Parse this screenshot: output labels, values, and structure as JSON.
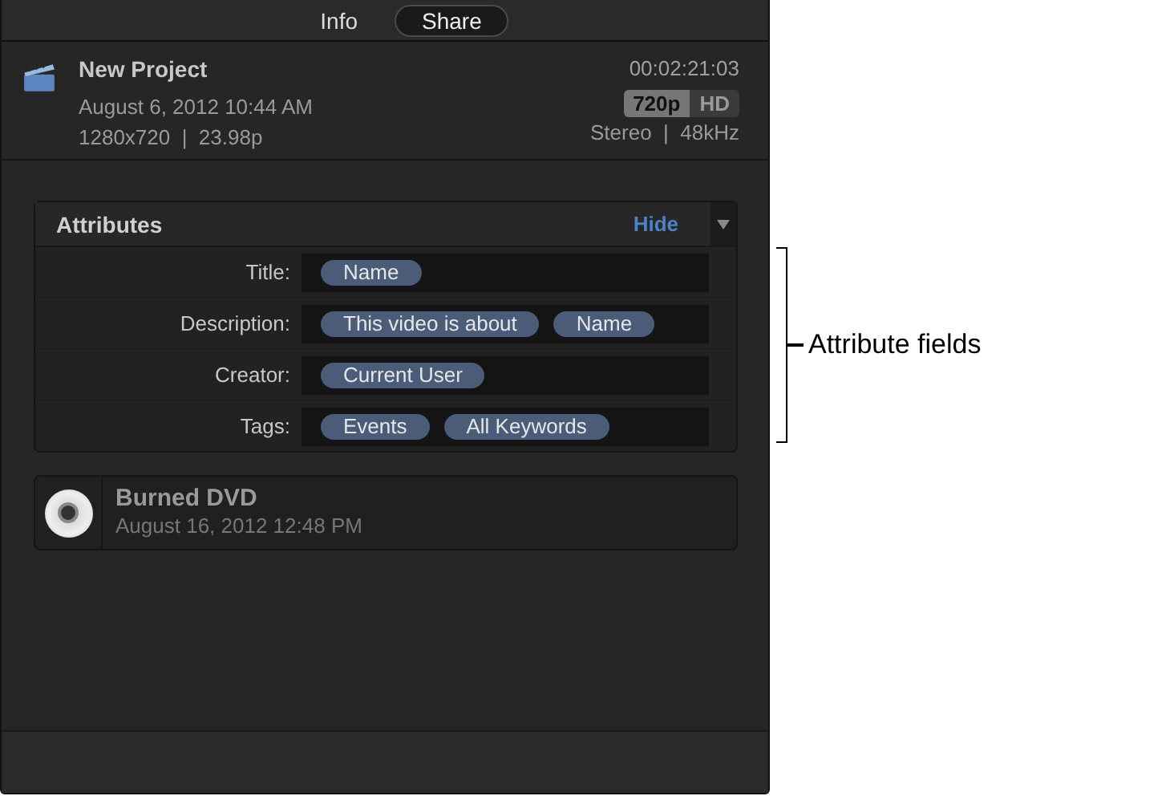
{
  "tabs": [
    {
      "label": "Info",
      "selected": false
    },
    {
      "label": "Share",
      "selected": true
    }
  ],
  "project": {
    "name": "New Project",
    "duration": "00:02:21:03",
    "date": "August 6, 2012 10:44 AM",
    "video_format": "1280x720  |  23.98p",
    "resolutions": [
      {
        "label": "720p",
        "selected": true
      },
      {
        "label": "HD",
        "selected": false
      }
    ],
    "audio_format": "Stereo  |  48kHz"
  },
  "attributes": {
    "title": "Attributes",
    "hide_button": "Hide",
    "rows": [
      {
        "label": "Title:",
        "tokens": [
          "Name"
        ]
      },
      {
        "label": "Description:",
        "tokens": [
          "This video is about",
          "Name"
        ]
      },
      {
        "label": "Creator:",
        "tokens": [
          "Current User"
        ]
      },
      {
        "label": "Tags:",
        "tokens": [
          "Events",
          "All Keywords"
        ]
      }
    ]
  },
  "share_history": [
    {
      "name": "Burned DVD",
      "date": "August 16, 2012 12:48 PM"
    }
  ],
  "annotation": {
    "label": "Attribute fields"
  }
}
